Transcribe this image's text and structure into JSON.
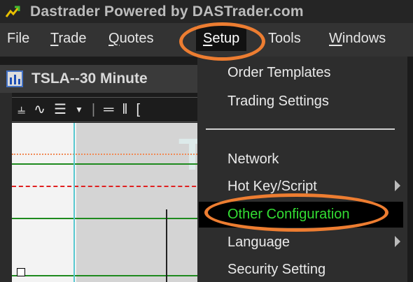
{
  "app": {
    "title": "Dastrader Powered by DASTrader.com",
    "icon": "chart-arrow-app-icon"
  },
  "menubar": {
    "items": [
      {
        "label": "File",
        "underline": "",
        "rest": "File"
      },
      {
        "label": "Trade",
        "underline": "T",
        "rest": "rade"
      },
      {
        "label": "Quotes",
        "underline": "Q",
        "rest": "uotes"
      },
      {
        "label": "Setup",
        "underline": "S",
        "rest": "etup"
      },
      {
        "label": "Tools",
        "underline": "",
        "rest": "Tools"
      },
      {
        "label": "Windows",
        "underline": "W",
        "rest": "indows"
      }
    ],
    "active": "Setup"
  },
  "chart_window": {
    "title": "TSLA--30 Minute",
    "toolbar_icons": [
      "bar-chart-icon",
      "indicator-icon",
      "study-list-icon",
      "dropdown-arrow-icon",
      "horizontal-line-icon",
      "vertical-line-icon",
      "bracket-icon"
    ]
  },
  "setup_menu": {
    "items": [
      {
        "label": "Order Templates",
        "has_submenu": false
      },
      {
        "label": "Trading Settings",
        "has_submenu": false
      },
      {
        "label": "Network",
        "has_submenu": false
      },
      {
        "label": "Hot Key/Script",
        "has_submenu": true
      },
      {
        "label": "Other Configuration",
        "has_submenu": false,
        "highlighted": true
      },
      {
        "label": "Language",
        "has_submenu": true
      },
      {
        "label": "Security Setting",
        "has_submenu": false
      }
    ],
    "highlight_color": "#33dd33"
  },
  "annotations": {
    "callout_color": "#ed7d31"
  }
}
